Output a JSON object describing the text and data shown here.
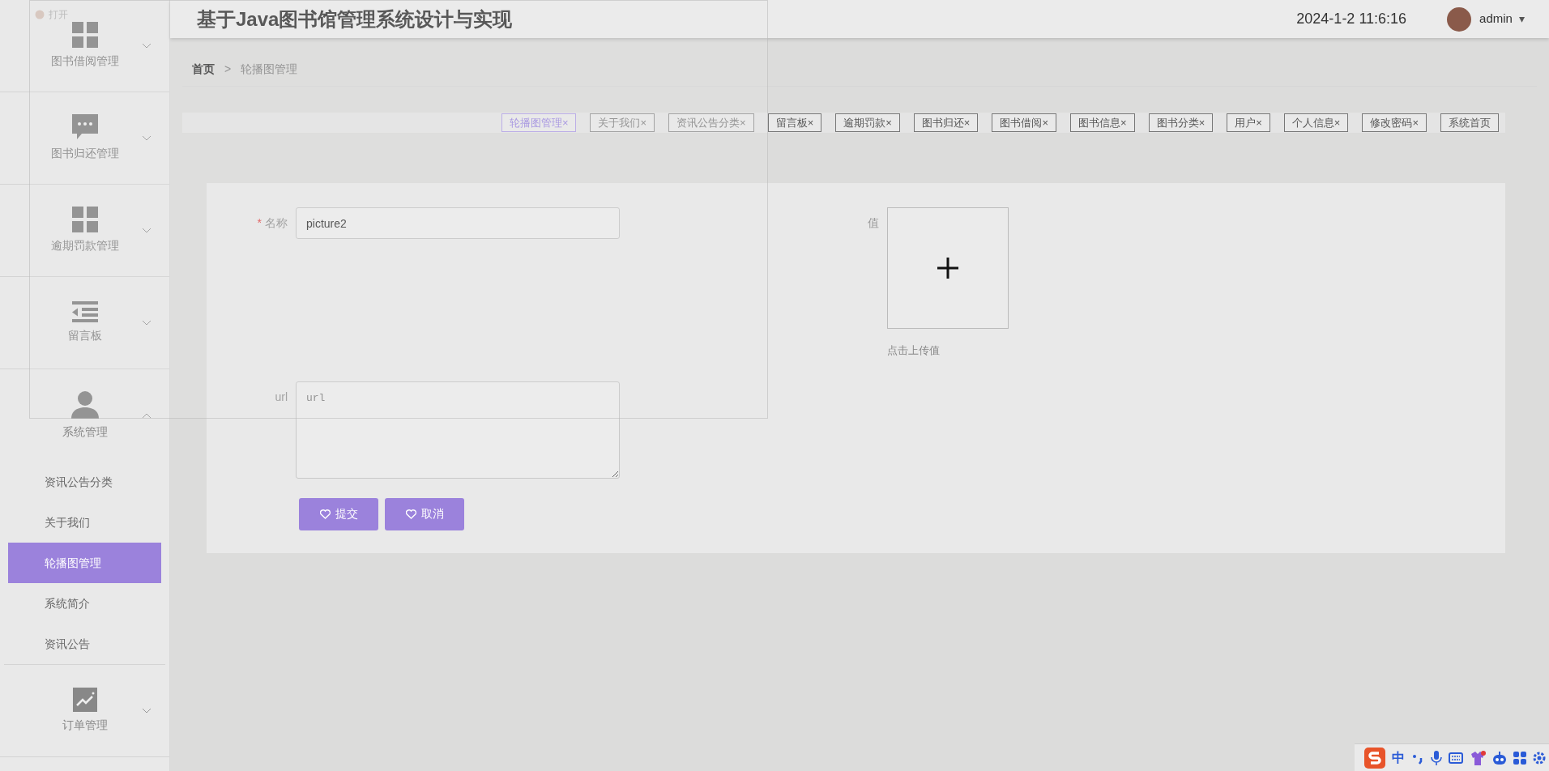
{
  "ghost_window": {
    "title": "打开"
  },
  "header": {
    "title": "基于Java图书馆管理系统设计与实现",
    "datetime": "2024-1-2 11:6:16",
    "user": "admin",
    "caret": "▾"
  },
  "sidebar": {
    "groups": [
      {
        "label": "图书借阅管理",
        "expanded": false
      },
      {
        "label": "图书归还管理",
        "expanded": false
      },
      {
        "label": "逾期罚款管理",
        "expanded": false
      },
      {
        "label": "留言板",
        "expanded": false
      },
      {
        "label": "系统管理",
        "expanded": true,
        "children": [
          {
            "label": "资讯公告分类",
            "selected": false
          },
          {
            "label": "关于我们",
            "selected": false
          },
          {
            "label": "轮播图管理",
            "selected": true
          },
          {
            "label": "系统简介",
            "selected": false
          },
          {
            "label": "资讯公告",
            "selected": false
          }
        ]
      },
      {
        "label": "订单管理",
        "expanded": false
      }
    ]
  },
  "breadcrumb": {
    "home": "首页",
    "separator": ">",
    "current": "轮播图管理"
  },
  "tabs": [
    {
      "label": "轮播图管理",
      "close": "×",
      "selected": true
    },
    {
      "label": "关于我们",
      "close": "×",
      "selected": false
    },
    {
      "label": "资讯公告分类",
      "close": "×",
      "selected": false
    },
    {
      "label": "留言板",
      "close": "×",
      "selected": false
    },
    {
      "label": "逾期罚款",
      "close": "×",
      "selected": false
    },
    {
      "label": "图书归还",
      "close": "×",
      "selected": false
    },
    {
      "label": "图书借阅",
      "close": "×",
      "selected": false
    },
    {
      "label": "图书信息",
      "close": "×",
      "selected": false
    },
    {
      "label": "图书分类",
      "close": "×",
      "selected": false
    },
    {
      "label": "用户",
      "close": "×",
      "selected": false
    },
    {
      "label": "个人信息",
      "close": "×",
      "selected": false
    },
    {
      "label": "修改密码",
      "close": "×",
      "selected": false
    },
    {
      "label": "系统首页",
      "selected": false
    }
  ],
  "form": {
    "name_field": {
      "required_mark": "*",
      "label": "名称",
      "value": "picture2"
    },
    "value_field": {
      "label": "值",
      "hint": "点击上传值"
    },
    "url_field": {
      "label": "url",
      "placeholder": "url"
    },
    "buttons": [
      "提交",
      "取消"
    ]
  },
  "ime_toolbar": {
    "mode": "中"
  }
}
